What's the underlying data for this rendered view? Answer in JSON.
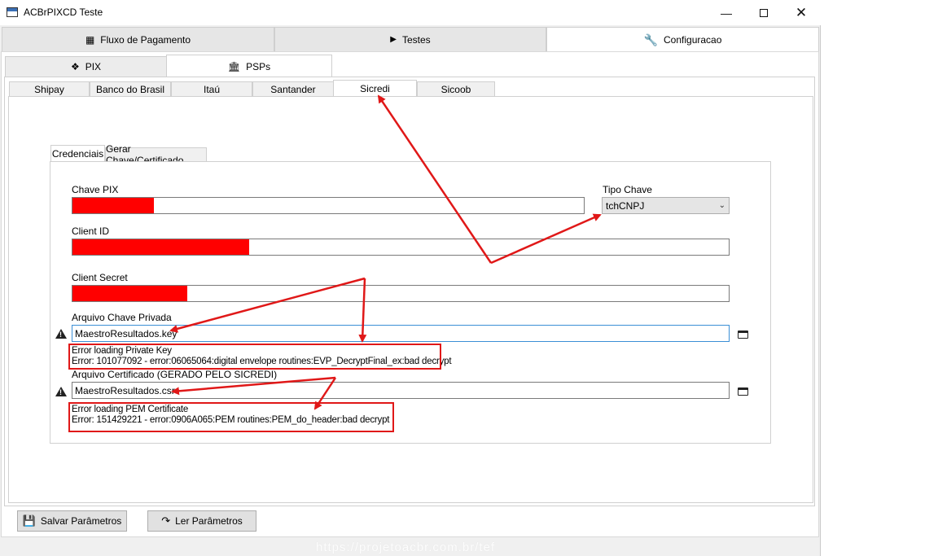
{
  "window": {
    "title": "ACBrPIXCD Teste"
  },
  "main_tabs": [
    {
      "label": "Fluxo de Pagamento",
      "icon": "qr-icon"
    },
    {
      "label": "Testes",
      "icon": "play-icon"
    },
    {
      "label": "Configuracao",
      "icon": "wrench-icon",
      "active": true
    }
  ],
  "sub_tabs": [
    {
      "label": "PIX",
      "icon": "pix-icon"
    },
    {
      "label": "PSPs",
      "icon": "bank-icon",
      "active": true
    }
  ],
  "psp_tabs": [
    "Shipay",
    "Banco do Brasil",
    "Itaú",
    "Santander",
    "Sicredi",
    "Sicoob"
  ],
  "psp_active": "Sicredi",
  "cred_tabs": [
    "Credenciais",
    "Gerar Chave/Certificado"
  ],
  "form": {
    "chave_pix_label": "Chave PIX",
    "tipo_chave_label": "Tipo Chave",
    "tipo_chave_value": "tchCNPJ",
    "client_id_label": "Client ID",
    "client_secret_label": "Client Secret",
    "arquivo_chave_label": "Arquivo Chave Privada",
    "arquivo_chave_value": "MaestroResultados.key",
    "chave_error_line1": "Error loading Private Key",
    "chave_error_line2": "Error: 101077092 - error:06065064:digital envelope routines:EVP_DecryptFinal_ex:bad decrypt",
    "arquivo_cert_label": "Arquivo Certificado (GERADO PELO SICREDI)",
    "arquivo_cert_value": "MaestroResultados.csr",
    "cert_error_line1": "Error loading PEM Certificate",
    "cert_error_line2": "Error: 151429221 - error:0906A065:PEM routines:PEM_do_header:bad decrypt"
  },
  "buttons": {
    "salvar": "Salvar Parâmetros",
    "ler": "Ler Parâmetros"
  },
  "watermark": "https://projetoacbr.com.br/tef",
  "colors": {
    "redaction": "#ff0000",
    "annotation": "#e01818"
  }
}
